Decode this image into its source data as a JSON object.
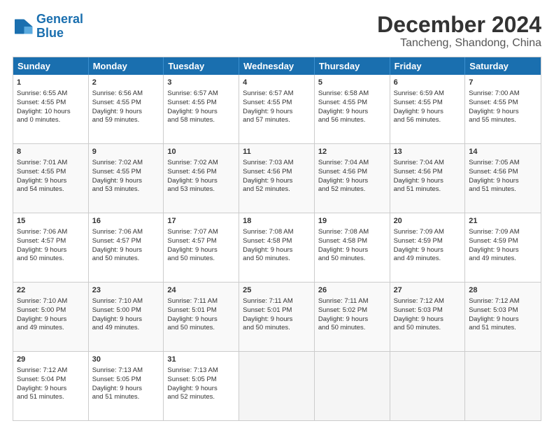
{
  "logo": {
    "line1": "General",
    "line2": "Blue"
  },
  "title": "December 2024",
  "subtitle": "Tancheng, Shandong, China",
  "header_days": [
    "Sunday",
    "Monday",
    "Tuesday",
    "Wednesday",
    "Thursday",
    "Friday",
    "Saturday"
  ],
  "weeks": [
    [
      {
        "day": "1",
        "info": "Sunrise: 6:55 AM\nSunset: 4:55 PM\nDaylight: 10 hours\nand 0 minutes."
      },
      {
        "day": "2",
        "info": "Sunrise: 6:56 AM\nSunset: 4:55 PM\nDaylight: 9 hours\nand 59 minutes."
      },
      {
        "day": "3",
        "info": "Sunrise: 6:57 AM\nSunset: 4:55 PM\nDaylight: 9 hours\nand 58 minutes."
      },
      {
        "day": "4",
        "info": "Sunrise: 6:57 AM\nSunset: 4:55 PM\nDaylight: 9 hours\nand 57 minutes."
      },
      {
        "day": "5",
        "info": "Sunrise: 6:58 AM\nSunset: 4:55 PM\nDaylight: 9 hours\nand 56 minutes."
      },
      {
        "day": "6",
        "info": "Sunrise: 6:59 AM\nSunset: 4:55 PM\nDaylight: 9 hours\nand 56 minutes."
      },
      {
        "day": "7",
        "info": "Sunrise: 7:00 AM\nSunset: 4:55 PM\nDaylight: 9 hours\nand 55 minutes."
      }
    ],
    [
      {
        "day": "8",
        "info": "Sunrise: 7:01 AM\nSunset: 4:55 PM\nDaylight: 9 hours\nand 54 minutes."
      },
      {
        "day": "9",
        "info": "Sunrise: 7:02 AM\nSunset: 4:55 PM\nDaylight: 9 hours\nand 53 minutes."
      },
      {
        "day": "10",
        "info": "Sunrise: 7:02 AM\nSunset: 4:56 PM\nDaylight: 9 hours\nand 53 minutes."
      },
      {
        "day": "11",
        "info": "Sunrise: 7:03 AM\nSunset: 4:56 PM\nDaylight: 9 hours\nand 52 minutes."
      },
      {
        "day": "12",
        "info": "Sunrise: 7:04 AM\nSunset: 4:56 PM\nDaylight: 9 hours\nand 52 minutes."
      },
      {
        "day": "13",
        "info": "Sunrise: 7:04 AM\nSunset: 4:56 PM\nDaylight: 9 hours\nand 51 minutes."
      },
      {
        "day": "14",
        "info": "Sunrise: 7:05 AM\nSunset: 4:56 PM\nDaylight: 9 hours\nand 51 minutes."
      }
    ],
    [
      {
        "day": "15",
        "info": "Sunrise: 7:06 AM\nSunset: 4:57 PM\nDaylight: 9 hours\nand 50 minutes."
      },
      {
        "day": "16",
        "info": "Sunrise: 7:06 AM\nSunset: 4:57 PM\nDaylight: 9 hours\nand 50 minutes."
      },
      {
        "day": "17",
        "info": "Sunrise: 7:07 AM\nSunset: 4:57 PM\nDaylight: 9 hours\nand 50 minutes."
      },
      {
        "day": "18",
        "info": "Sunrise: 7:08 AM\nSunset: 4:58 PM\nDaylight: 9 hours\nand 50 minutes."
      },
      {
        "day": "19",
        "info": "Sunrise: 7:08 AM\nSunset: 4:58 PM\nDaylight: 9 hours\nand 50 minutes."
      },
      {
        "day": "20",
        "info": "Sunrise: 7:09 AM\nSunset: 4:59 PM\nDaylight: 9 hours\nand 49 minutes."
      },
      {
        "day": "21",
        "info": "Sunrise: 7:09 AM\nSunset: 4:59 PM\nDaylight: 9 hours\nand 49 minutes."
      }
    ],
    [
      {
        "day": "22",
        "info": "Sunrise: 7:10 AM\nSunset: 5:00 PM\nDaylight: 9 hours\nand 49 minutes."
      },
      {
        "day": "23",
        "info": "Sunrise: 7:10 AM\nSunset: 5:00 PM\nDaylight: 9 hours\nand 49 minutes."
      },
      {
        "day": "24",
        "info": "Sunrise: 7:11 AM\nSunset: 5:01 PM\nDaylight: 9 hours\nand 50 minutes."
      },
      {
        "day": "25",
        "info": "Sunrise: 7:11 AM\nSunset: 5:01 PM\nDaylight: 9 hours\nand 50 minutes."
      },
      {
        "day": "26",
        "info": "Sunrise: 7:11 AM\nSunset: 5:02 PM\nDaylight: 9 hours\nand 50 minutes."
      },
      {
        "day": "27",
        "info": "Sunrise: 7:12 AM\nSunset: 5:03 PM\nDaylight: 9 hours\nand 50 minutes."
      },
      {
        "day": "28",
        "info": "Sunrise: 7:12 AM\nSunset: 5:03 PM\nDaylight: 9 hours\nand 51 minutes."
      }
    ],
    [
      {
        "day": "29",
        "info": "Sunrise: 7:12 AM\nSunset: 5:04 PM\nDaylight: 9 hours\nand 51 minutes."
      },
      {
        "day": "30",
        "info": "Sunrise: 7:13 AM\nSunset: 5:05 PM\nDaylight: 9 hours\nand 51 minutes."
      },
      {
        "day": "31",
        "info": "Sunrise: 7:13 AM\nSunset: 5:05 PM\nDaylight: 9 hours\nand 52 minutes."
      },
      {
        "day": "",
        "info": ""
      },
      {
        "day": "",
        "info": ""
      },
      {
        "day": "",
        "info": ""
      },
      {
        "day": "",
        "info": ""
      }
    ]
  ]
}
